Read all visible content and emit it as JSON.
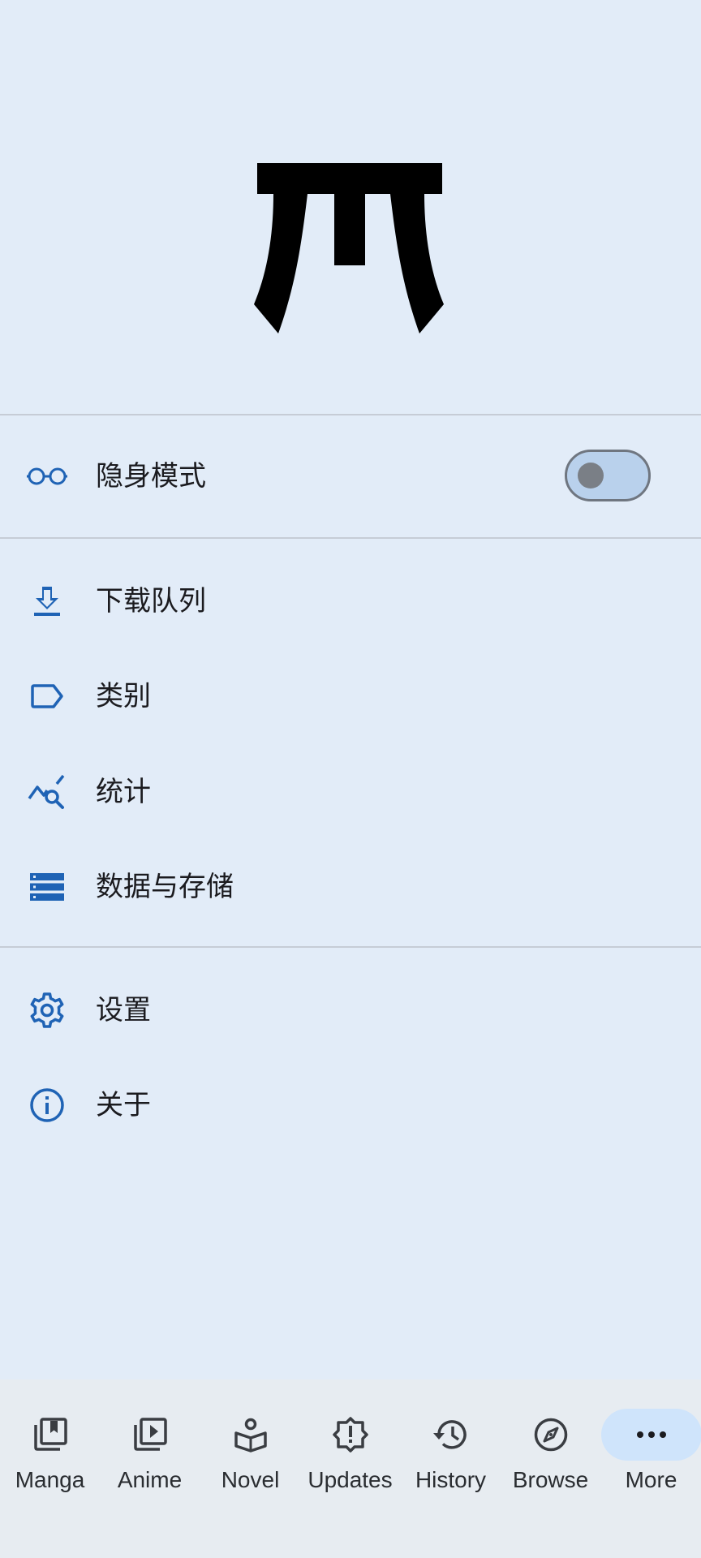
{
  "incognito": {
    "label": "隐身模式",
    "enabled": false
  },
  "menu_group1": [
    {
      "label": "下载队列",
      "icon": "download-icon"
    },
    {
      "label": "类别",
      "icon": "label-icon"
    },
    {
      "label": "统计",
      "icon": "stats-icon"
    },
    {
      "label": "数据与存储",
      "icon": "storage-icon"
    }
  ],
  "menu_group2": [
    {
      "label": "设置",
      "icon": "gear-icon"
    },
    {
      "label": "关于",
      "icon": "info-icon"
    }
  ],
  "bottom_nav": [
    {
      "label": "Manga",
      "icon": "manga-icon"
    },
    {
      "label": "Anime",
      "icon": "anime-icon"
    },
    {
      "label": "Novel",
      "icon": "novel-icon"
    },
    {
      "label": "Updates",
      "icon": "updates-icon"
    },
    {
      "label": "History",
      "icon": "history-icon"
    },
    {
      "label": "Browse",
      "icon": "browse-icon"
    },
    {
      "label": "More",
      "icon": "more-icon",
      "active": true
    }
  ],
  "colors": {
    "background": "#e2ecf8",
    "accent": "#1f63b5",
    "nav_background": "#e7ecf1",
    "active_pill": "#cfe4fb"
  }
}
